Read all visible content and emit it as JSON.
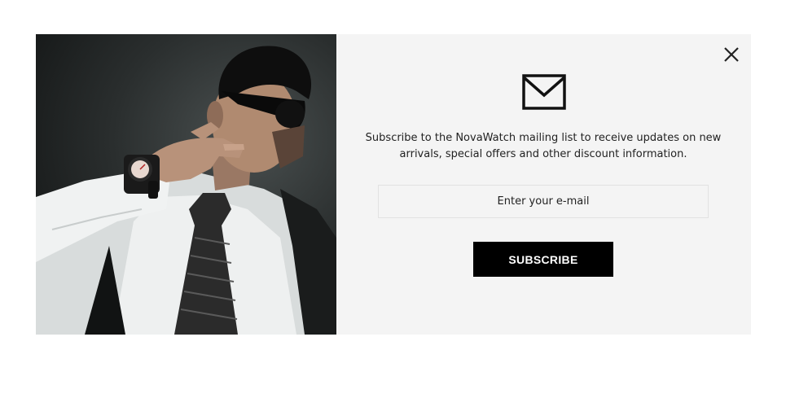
{
  "popup": {
    "image": {
      "subject": "model-with-wristwatch-photo"
    },
    "icons": {
      "close": "close-icon",
      "mail": "mail-envelope-icon"
    },
    "blurb": "Subscribe to the NovaWatch mailing list to receive updates on new arrivals, special offers and other discount information.",
    "email_placeholder": "Enter your e-mail",
    "email_value": "",
    "subscribe_label": "SUBSCRIBE"
  },
  "colors": {
    "panel_background": "#f4f4f4",
    "button_background": "#000000",
    "button_text": "#ffffff",
    "text": "#222222"
  }
}
